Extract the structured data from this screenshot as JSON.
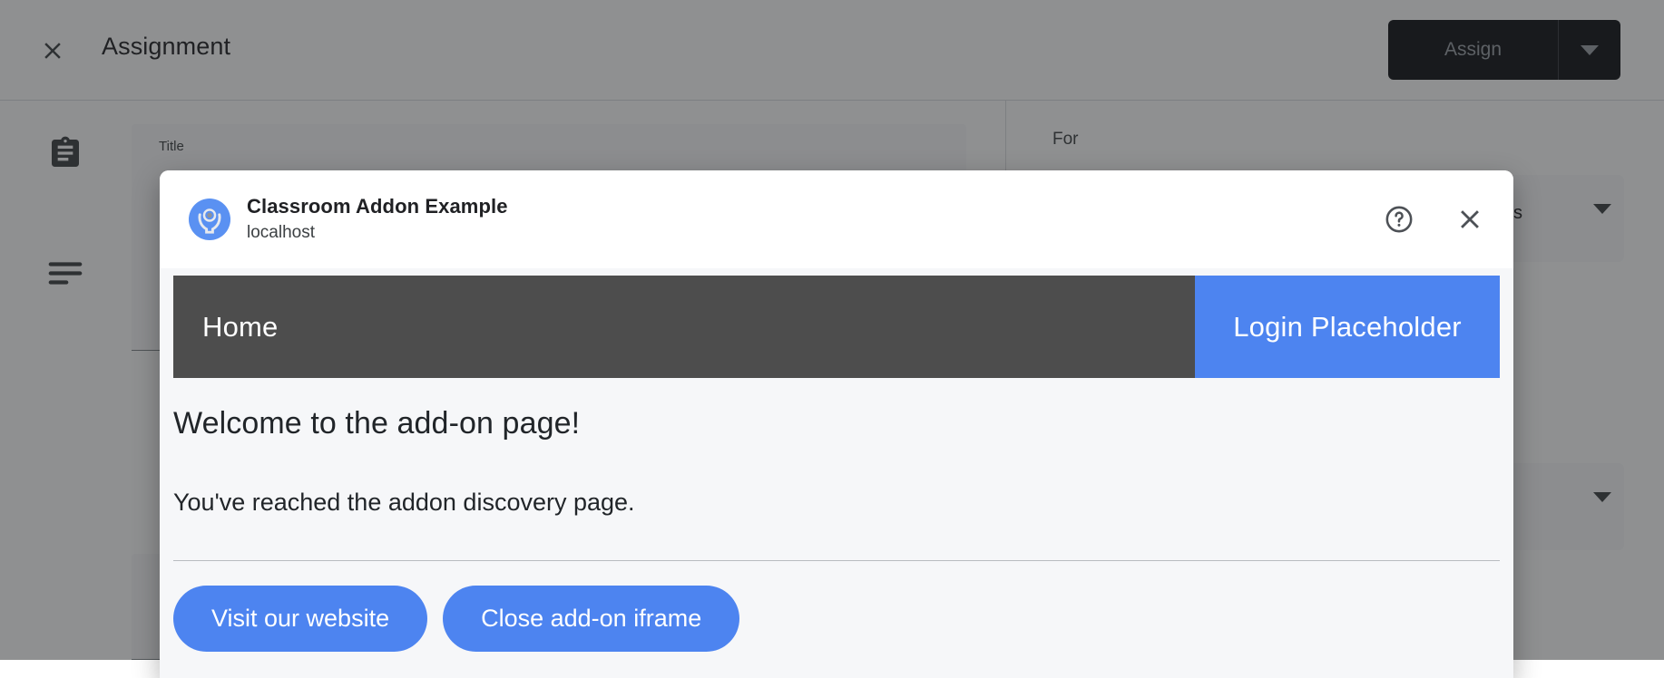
{
  "background": {
    "close_icon": "close-icon",
    "title": "Assignment",
    "assign_button": {
      "label": "Assign",
      "dropdown_icon": "chevron-down-icon"
    },
    "sidebar_icons": [
      {
        "name": "assignment-clipboard-icon"
      },
      {
        "name": "description-lines-icon"
      }
    ],
    "fields": {
      "title_label": "Title",
      "for_label": "For",
      "audience_value": "s",
      "audience_caret_icon": "chevron-down-icon",
      "topic_caret_icon": "chevron-down-icon"
    }
  },
  "dialog": {
    "app_icon": "classroom-addon-icon",
    "app_name": "Classroom Addon Example",
    "app_host": "localhost",
    "help_icon": "help-circle-icon",
    "close_icon": "close-icon"
  },
  "addon": {
    "navbar": {
      "home_label": "Home",
      "login_label": "Login Placeholder"
    },
    "heading": "Welcome to the add-on page!",
    "subtext": "You've reached the addon discovery page.",
    "buttons": [
      {
        "label": "Visit our website"
      },
      {
        "label": "Close add-on iframe"
      }
    ]
  },
  "colors": {
    "accent_blue": "#4d84f0",
    "navbar_dark": "#4d4d4d",
    "assign_dark": "#111217",
    "iframe_bg": "#f6f7f9"
  }
}
